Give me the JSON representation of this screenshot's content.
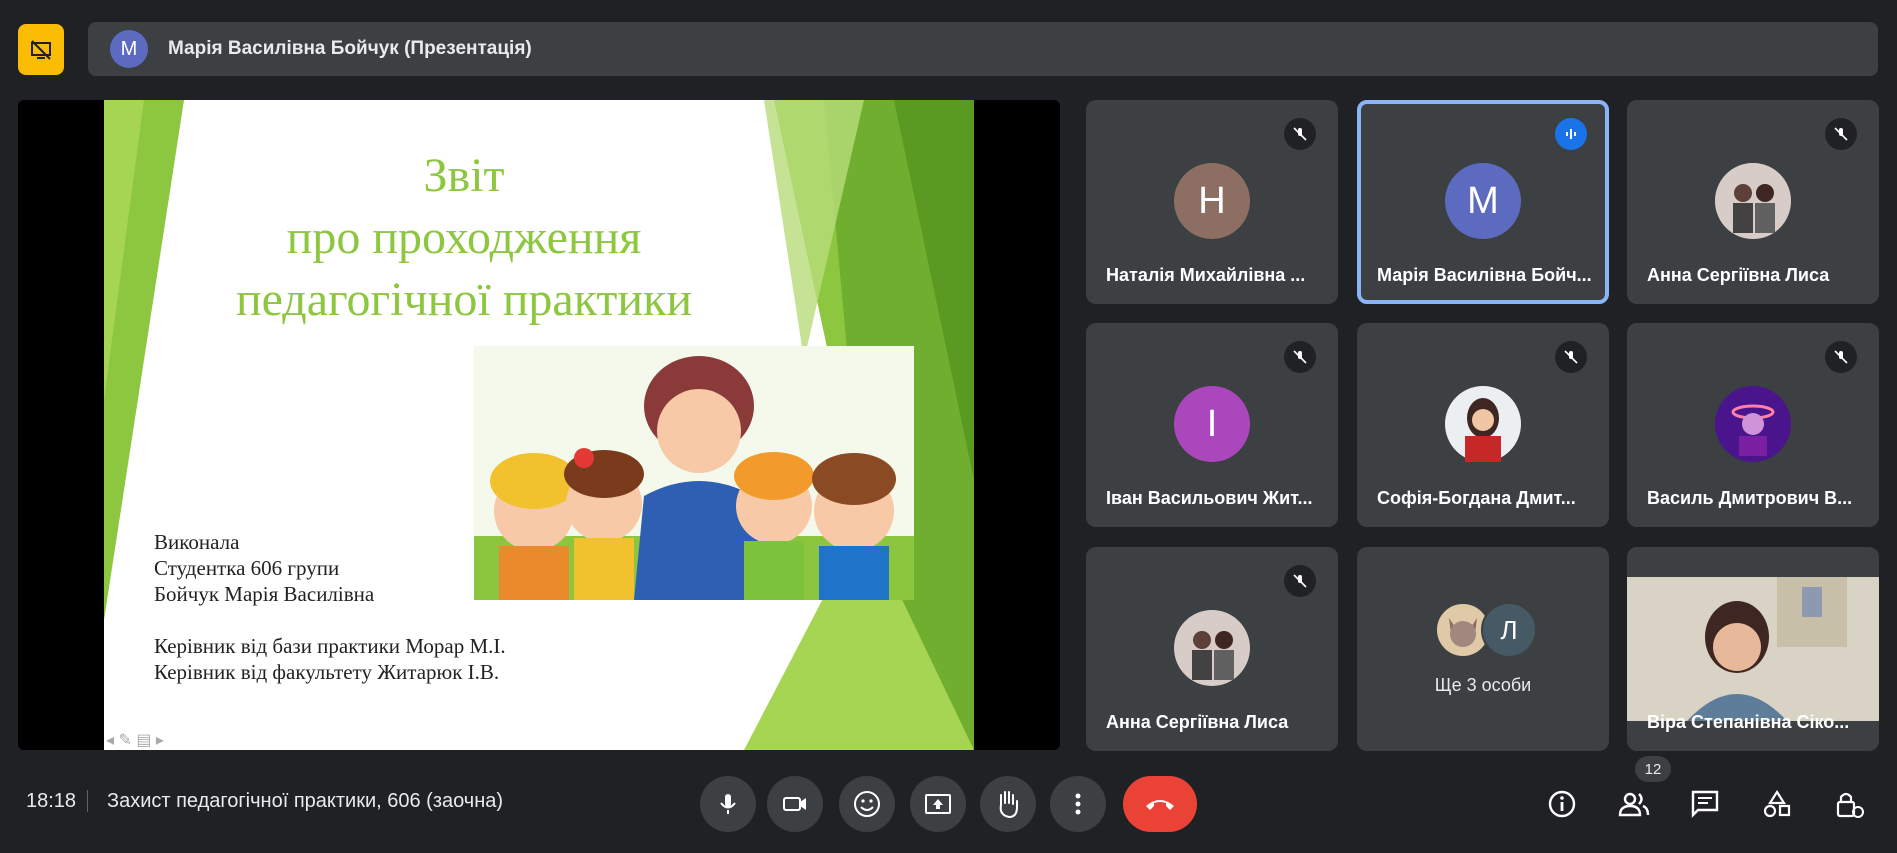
{
  "header": {
    "presenter_initial": "М",
    "presenter_label": "Марія Василівна Бойчук (Презентація)"
  },
  "slide": {
    "title_line1": "Звіт",
    "title_line2": "про проходження",
    "title_line3": "педагогічної практики",
    "author_line1": "Виконала",
    "author_line2": "Студентка 606 групи",
    "author_line3": "Бойчук Марія Василівна",
    "supervisor_line1": "Керівник від бази практики Морар М.І.",
    "supervisor_line2": "Керівник від факультету Житарюк І.В."
  },
  "participants": [
    {
      "initial": "Н",
      "name": "Наталія Михайлівна ...",
      "avatar_color": "#8d6e63",
      "state": "muted"
    },
    {
      "initial": "М",
      "name": "Марія Василівна Бойч...",
      "avatar_color": "#5c6bc0",
      "state": "speaking"
    },
    {
      "initial": "",
      "name": "Анна Сергіївна Лиса",
      "avatar_color": "#9e9e9e",
      "state": "muted"
    },
    {
      "initial": "І",
      "name": "Іван Васильович Жит...",
      "avatar_color": "#ab47bc",
      "state": "muted"
    },
    {
      "initial": "",
      "name": "Софія-Богдана Дмит...",
      "avatar_color": "#c62828",
      "state": "muted"
    },
    {
      "initial": "",
      "name": "Василь Дмитрович В...",
      "avatar_color": "#4a148c",
      "state": "muted"
    },
    {
      "initial": "",
      "name": "Анна Сергіївна Лиса",
      "avatar_color": "#9e9e9e",
      "state": "muted"
    },
    {
      "initial": "Л",
      "name": "Ще 3 особи",
      "avatar_color": "#455a64",
      "state": "group"
    },
    {
      "initial": "",
      "name": "Віра Степанівна Сіко...",
      "avatar_color": "#7b6a5a",
      "state": "video"
    }
  ],
  "footer": {
    "time": "18:18",
    "meeting_title": "Захист педагогічної практики, 606 (заочна)",
    "people_count": "12"
  },
  "colors": {
    "background": "#202124",
    "tile": "#3c4043",
    "accent": "#8ab4f8",
    "hangup": "#ea4335",
    "presenting_badge": "#fbbc04"
  },
  "icons": [
    "presenting-off-icon",
    "mic-off-icon",
    "audio-level-icon",
    "mic-icon",
    "camera-icon",
    "emoji-icon",
    "present-icon",
    "raise-hand-icon",
    "more-vert-icon",
    "hangup-icon",
    "info-icon",
    "people-icon",
    "chat-icon",
    "activities-icon",
    "host-controls-icon"
  ]
}
